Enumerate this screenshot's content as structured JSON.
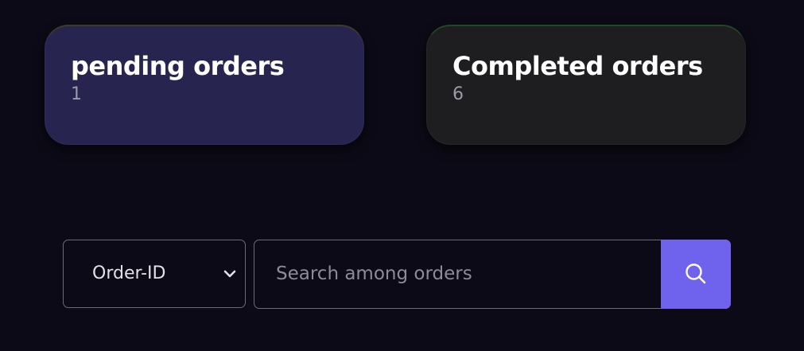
{
  "cards": {
    "pending": {
      "title": "pending orders",
      "count": "1"
    },
    "completed": {
      "title": "Completed orders",
      "count": "6"
    }
  },
  "search": {
    "filter_selected": "Order-ID",
    "placeholder": "Search among orders",
    "value": ""
  },
  "icons": {
    "dropdown": "chevron-down-icon",
    "search": "search-icon"
  },
  "colors": {
    "background": "#0b0a16",
    "pending_card": "#27244f",
    "completed_card": "#1e1e20",
    "accent": "#6f63ee"
  }
}
